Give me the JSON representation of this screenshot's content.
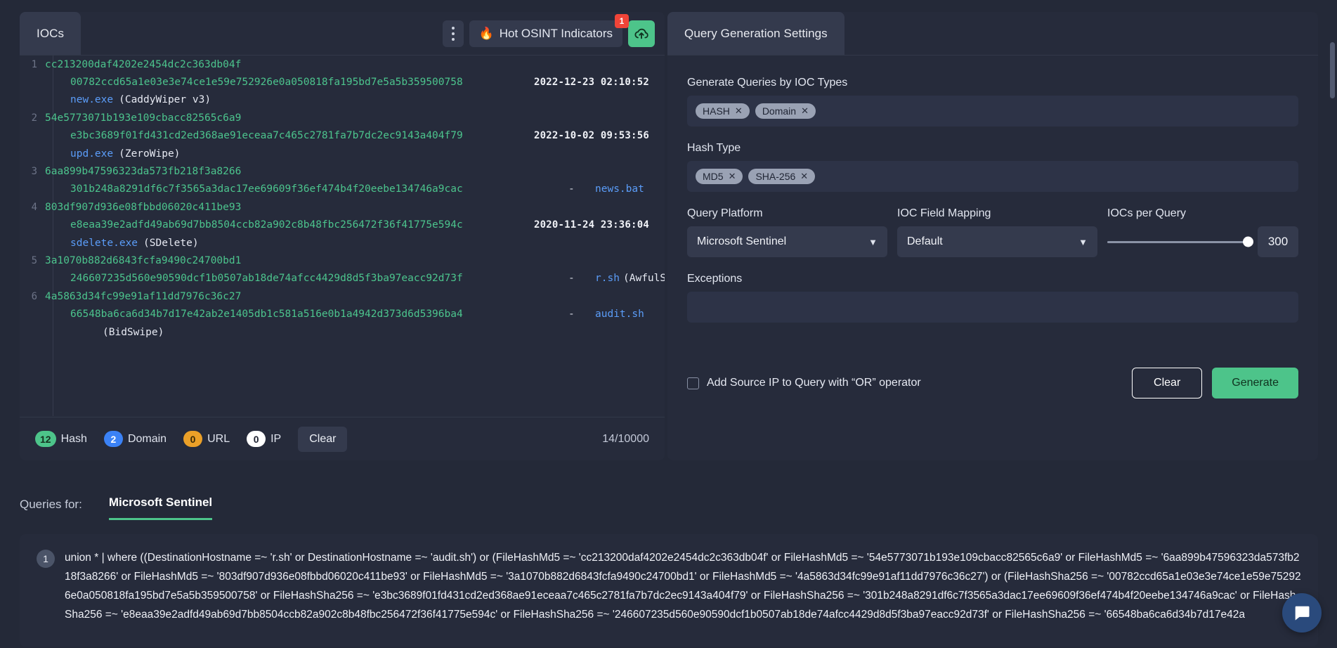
{
  "left_panel": {
    "tab_label": "IOCs",
    "kebab_icon": "kebab-menu-icon",
    "hot_osint": {
      "label": "Hot OSINT Indicators",
      "badge": "1",
      "flame_icon": "flame-icon"
    },
    "upload_icon": "cloud-upload-icon",
    "editor_rows": [
      {
        "num": "1",
        "hash": "cc213200daf4202e2454dc2c363db04f",
        "indent_hash": "00782ccd65a1e03e3e74ce1e59e752926e0a050818fa195bd7e5a5b359500758",
        "timestamp": "2022-12-23 02:10:52",
        "file": "new.exe",
        "label": "(CaddyWiper v3)"
      },
      {
        "num": "2",
        "hash": "54e5773071b193e109cbacc82565c6a9",
        "indent_hash": "e3bc3689f01fd431cd2ed368ae91eceaa7c465c2781fa7b7dc2ec9143a404f79",
        "timestamp": "2022-10-02 09:53:56",
        "file": "upd.exe",
        "label": "(ZeroWipe)"
      },
      {
        "num": "3",
        "hash": "6aa899b47596323da573fb218f3a8266",
        "indent_hash": "301b248a8291df6c7f3565a3dac17ee69609f36ef474b4f20eebe134746a9cac",
        "timestamp": "-",
        "file": "news.bat",
        "label": ""
      },
      {
        "num": "4",
        "hash": "803df907d936e08fbbd06020c411be93",
        "indent_hash": "e8eaa39e2adfd49ab69d7bb8504ccb82a902c8b48fbc256472f36f41775e594c",
        "timestamp": "2020-11-24 23:36:04",
        "file": "sdelete.exe",
        "label": "(SDelete)"
      },
      {
        "num": "5",
        "hash": "3a1070b882d6843fcfa9490c24700bd1",
        "indent_hash": "246607235d560e90590dcf1b0507ab18de74afcc4429d8d5f3ba97eacc92d73f",
        "timestamp": "-",
        "file": "r.sh",
        "label": "(AwfulShred)"
      },
      {
        "num": "6",
        "hash": "4a5863d34fc99e91af11dd7976c36c27",
        "indent_hash": "66548ba6ca6d34b7d17e42ab2e1405db1c581a516e0b1a4942d373d6d5396ba4",
        "timestamp": "-",
        "file": "audit.sh",
        "label": "",
        "trailing_label": "(BidSwipe)"
      }
    ],
    "status": {
      "hash_count": "12",
      "hash_label": "Hash",
      "domain_count": "2",
      "domain_label": "Domain",
      "url_count": "0",
      "url_label": "URL",
      "ip_count": "0",
      "ip_label": "IP",
      "clear_label": "Clear",
      "char_count": "14/10000"
    }
  },
  "right_panel": {
    "tab_label": "Query Generation Settings",
    "ioc_types": {
      "label": "Generate Queries by IOC Types",
      "tags": [
        "HASH",
        "Domain"
      ]
    },
    "hash_type": {
      "label": "Hash Type",
      "tags": [
        "MD5",
        "SHA-256"
      ]
    },
    "query_platform": {
      "label": "Query Platform",
      "value": "Microsoft Sentinel"
    },
    "ioc_field_mapping": {
      "label": "IOC Field Mapping",
      "value": "Default"
    },
    "iocs_per_query": {
      "label": "IOCs per Query",
      "value": "300"
    },
    "exceptions": {
      "label": "Exceptions",
      "value": ""
    },
    "add_source_ip_label": "Add Source IP to Query with “OR” operator",
    "clear_label": "Clear",
    "generate_label": "Generate"
  },
  "queries": {
    "for_label": "Queries for:",
    "tab_label": "Microsoft Sentinel",
    "items": [
      {
        "num": "1",
        "text": "union * | where ((DestinationHostname =~ 'r.sh' or DestinationHostname =~ 'audit.sh') or (FileHashMd5 =~ 'cc213200daf4202e2454dc2c363db04f' or FileHashMd5 =~ '54e5773071b193e109cbacc82565c6a9' or FileHashMd5 =~ '6aa899b47596323da573fb218f3a8266' or FileHashMd5 =~ '803df907d936e08fbbd06020c411be93' or FileHashMd5 =~ '3a1070b882d6843fcfa9490c24700bd1' or FileHashMd5 =~ '4a5863d34fc99e91af11dd7976c36c27') or (FileHashSha256 =~ '00782ccd65a1e03e3e74ce1e59e752926e0a050818fa195bd7e5a5b359500758' or FileHashSha256 =~ 'e3bc3689f01fd431cd2ed368ae91eceaa7c465c2781fa7b7dc2ec9143a404f79' or FileHashSha256 =~ '301b248a8291df6c7f3565a3dac17ee69609f36ef474b4f20eebe134746a9cac' or FileHashSha256 =~ 'e8eaa39e2adfd49ab69d7bb8504ccb82a902c8b48fbc256472f36f41775e594c' or FileHashSha256 =~ '246607235d560e90590dcf1b0507ab18de74afcc4429d8d5f3ba97eacc92d73f' or FileHashSha256 =~ '66548ba6ca6d34b7d17e42a"
      }
    ]
  },
  "chat_icon": "chat-bubble-icon",
  "colors": {
    "accent_green": "#4dc48a",
    "badge_red": "#f04438",
    "domain_blue": "#3b82f6",
    "url_orange": "#eba028",
    "hash_green": "#4cc48d",
    "file_blue": "#5b9df9"
  }
}
